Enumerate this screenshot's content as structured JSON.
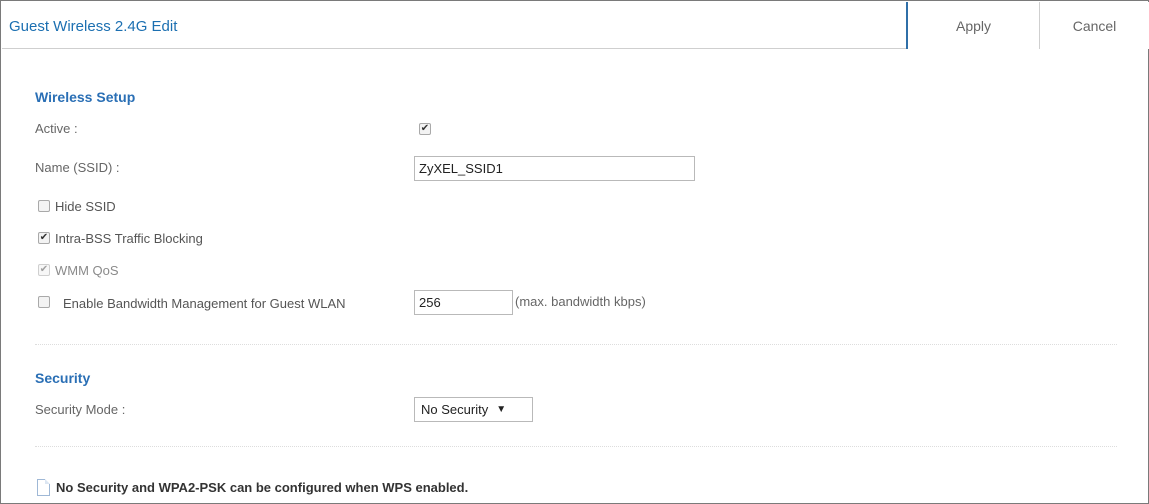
{
  "header": {
    "title": "Guest Wireless 2.4G Edit",
    "apply_label": "Apply",
    "cancel_label": "Cancel"
  },
  "wireless_setup": {
    "section_title": "Wireless Setup",
    "active_label": "Active :",
    "active_checked": true,
    "ssid_label": "Name (SSID) :",
    "ssid_value": "ZyXEL_SSID1",
    "hide_ssid_label": "Hide SSID",
    "hide_ssid_checked": false,
    "intra_bss_label": "Intra-BSS Traffic Blocking",
    "intra_bss_checked": true,
    "wmm_qos_label": "WMM QoS",
    "wmm_qos_checked": true,
    "wmm_qos_disabled": true,
    "bandwidth_label": "Enable Bandwidth Management for Guest WLAN",
    "bandwidth_checked": false,
    "bandwidth_value": "256",
    "bandwidth_hint": "(max. bandwidth kbps)"
  },
  "security": {
    "section_title": "Security",
    "mode_label": "Security Mode :",
    "mode_value": "No Security"
  },
  "note": {
    "text": "No Security and WPA2-PSK can be configured when WPS enabled."
  },
  "colors": {
    "title_blue": "#1b6fb1",
    "section_blue": "#2a6fb5",
    "apply_border": "#2f6fa8"
  },
  "icons": {
    "check": "check-icon",
    "dropdown": "triangle-down-icon",
    "note": "document-icon"
  }
}
